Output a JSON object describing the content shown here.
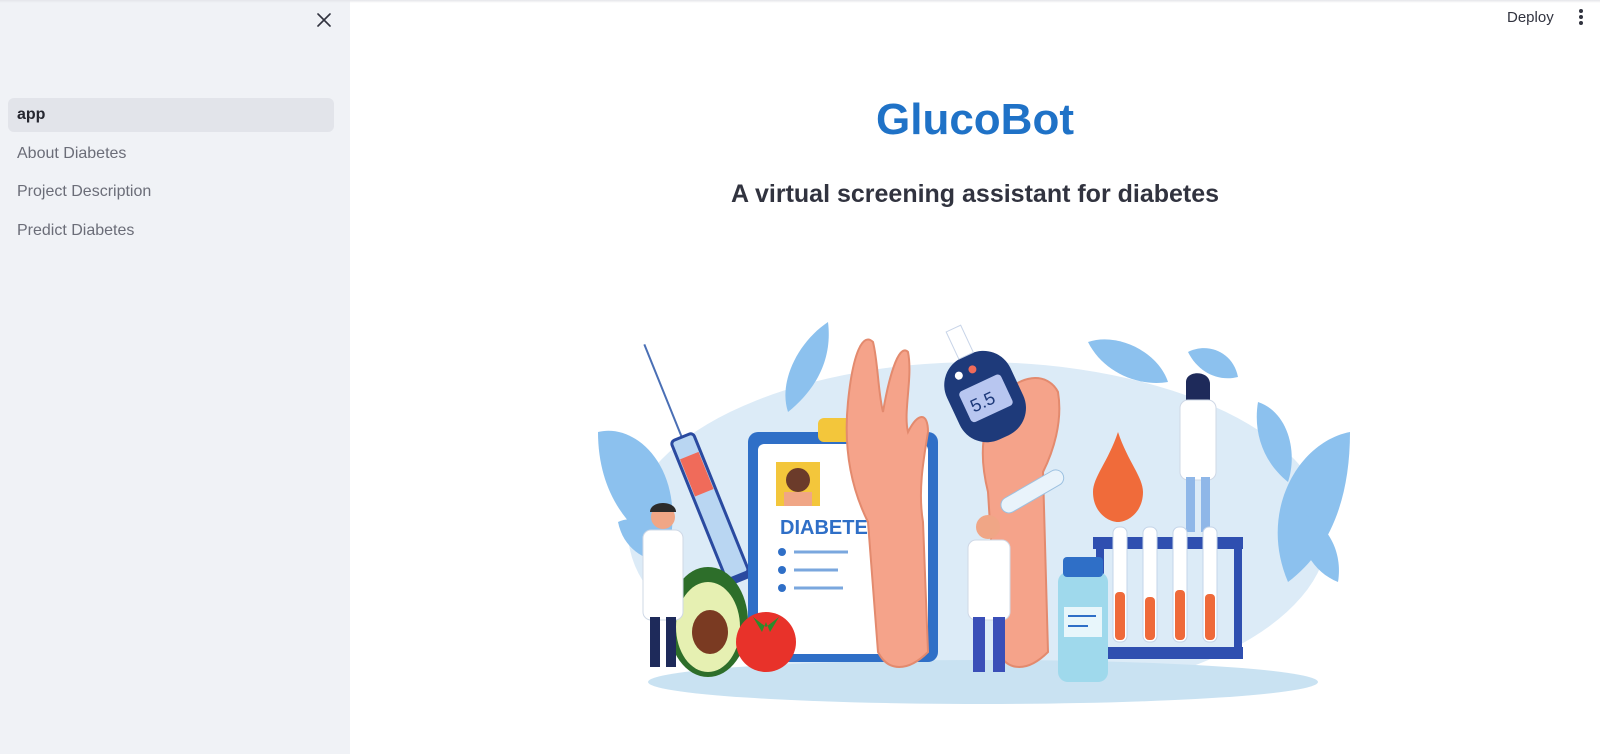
{
  "sidebar": {
    "items": [
      {
        "label": "app",
        "active": true
      },
      {
        "label": "About Diabetes",
        "active": false
      },
      {
        "label": "Project Description",
        "active": false
      },
      {
        "label": "Predict Diabetes",
        "active": false
      }
    ],
    "close_icon": "close-icon"
  },
  "header": {
    "deploy_label": "Deploy",
    "menu_icon": "kebab-menu-icon"
  },
  "main": {
    "title": "GlucoBot",
    "subtitle": "A virtual screening assistant for diabetes",
    "illustration": {
      "card_label": "DIABETES",
      "meter_reading": "5.5"
    }
  },
  "colors": {
    "title": "#1f72c7",
    "sidebar_bg": "#f0f2f6",
    "active_item_bg": "#e2e4ea"
  }
}
